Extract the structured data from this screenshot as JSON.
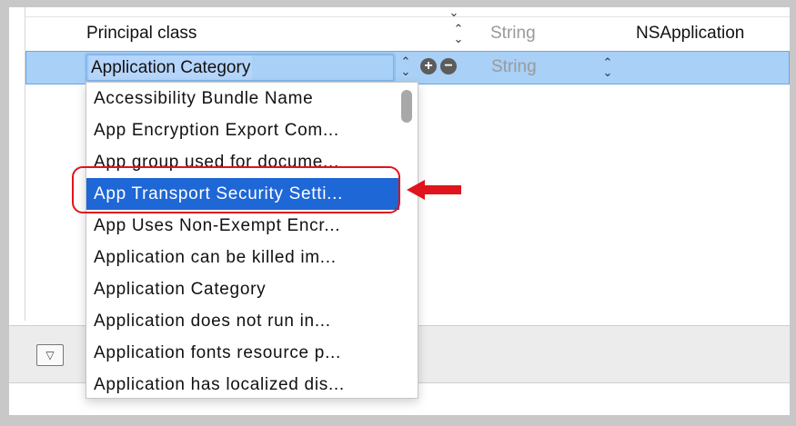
{
  "rows": {
    "principal": {
      "key": "Principal class",
      "type": "String",
      "value": "NSApplication"
    },
    "selected": {
      "key": "Application Category",
      "type": "String",
      "add_symbol": "+",
      "remove_symbol": "−"
    }
  },
  "popup": {
    "items": [
      "Accessibility Bundle Name",
      "App Encryption Export Com...",
      "App group used for docume...",
      "App Transport Security Setti...",
      "App Uses Non-Exempt Encr...",
      "Application can be killed im...",
      "Application Category",
      "Application does not run in...",
      "Application fonts resource p...",
      "Application has localized dis..."
    ],
    "highlighted": "App Transport Security Setti..."
  },
  "icons": {
    "stepper": "up-down-chevron-icon",
    "add": "plus-circle-icon",
    "remove": "minus-circle-icon",
    "disclosure": "triangle-down-icon",
    "annotation": "red-arrow-icon"
  },
  "colors": {
    "selection_row": "#a9d0f6",
    "highlight": "#1e67d6",
    "annotation": "#e0141c"
  }
}
